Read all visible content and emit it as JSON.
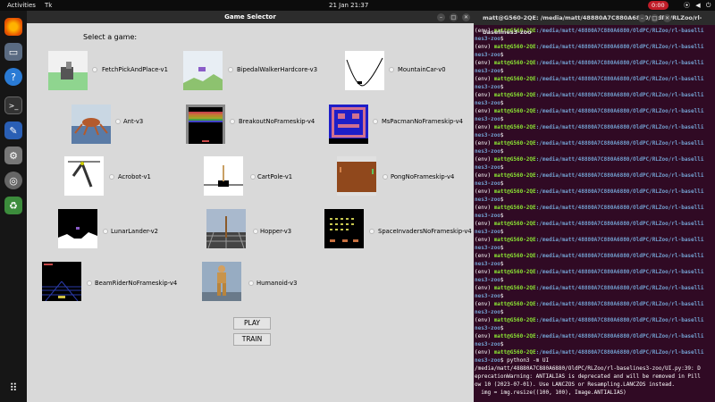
{
  "topbar": {
    "activities": "Activities",
    "app": "Tk",
    "clock": "21 Jan  21:37",
    "record": "0:00",
    "system": "⦿ ◀ ⏻"
  },
  "window": {
    "title": "Game Selector",
    "prompt": "Select a game:"
  },
  "games": [
    "FetchPickAndPlace-v1",
    "BipedalWalkerHardcore-v3",
    "MountainCar-v0",
    "Ant-v3",
    "BreakoutNoFrameskip-v4",
    "MsPacmanNoFrameskip-v4",
    "Acrobot-v1",
    "CartPole-v1",
    "PongNoFrameskip-v4",
    "LunarLander-v2",
    "Hopper-v3",
    "SpaceInvadersNoFrameskip-v4",
    "BeamRiderNoFrameskip-v4",
    "Humanoid-v3"
  ],
  "buttons": {
    "play": "PLAY",
    "train": "TRAIN"
  },
  "terminal": {
    "title": "matt@G560-2QE: /media/matt/48880A7C880A6880/OldPC/RLZoo/rl-baselines3-zoo",
    "env": "(env) ",
    "user": "matt@G560-2QE",
    "path": ":/media/matt/48880A7C880A6880/OldPC/RLZoo/rl-baselli",
    "wrap": "nes3-zoo",
    "command": "$ python3 -m UI",
    "warning": [
      "/media/matt/48880A7C880A6880/OldPC/RLZoo/rl-baselines3-zoo/UI.py:39: D",
      "eprecationWarning: ANTIALIAS is deprecated and will be removed in Pill",
      "ow 10 (2023-07-01). Use LANCZOS or Resampling.LANCZOS instead.",
      "  img = img.resize((100, 100), Image.ANTIALIAS)"
    ]
  }
}
